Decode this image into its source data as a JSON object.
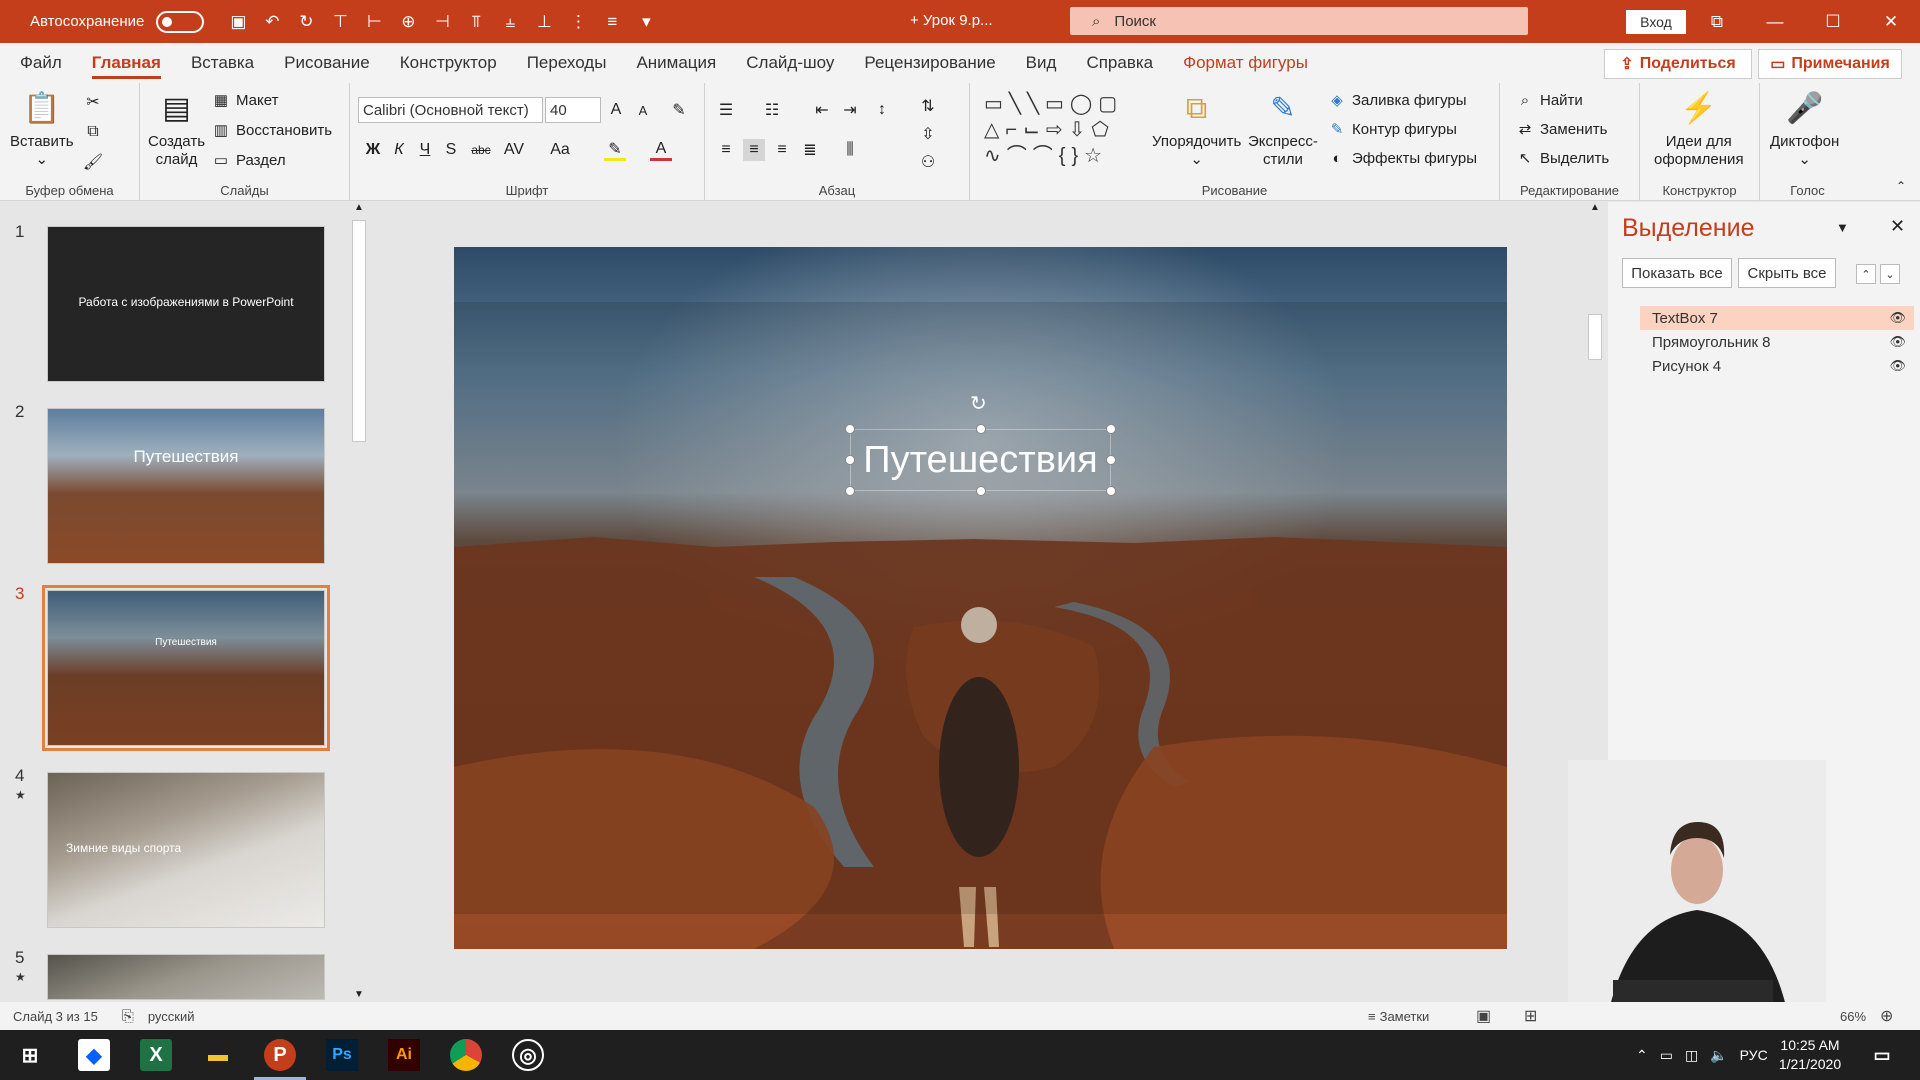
{
  "titlebar": {
    "autosave_label": "Автосохранение",
    "doc_title": "+ Урок 9.р...",
    "search_placeholder": "Поиск",
    "signin": "Вход"
  },
  "tabs": [
    "Файл",
    "Главная",
    "Вставка",
    "Рисование",
    "Конструктор",
    "Переходы",
    "Анимация",
    "Слайд-шоу",
    "Рецензирование",
    "Вид",
    "Справка"
  ],
  "context_tab": "Формат фигуры",
  "share": "Поделиться",
  "comments": "Примечания",
  "ribbon": {
    "clipboard": {
      "paste": "Вставить",
      "label": "Буфер обмена"
    },
    "slides": {
      "new_slide_1": "Создать",
      "new_slide_2": "слайд",
      "layout": "Макет",
      "reset": "Восстановить",
      "section": "Раздел",
      "label": "Слайды"
    },
    "font": {
      "name": "Calibri (Основной текст)",
      "size": "40",
      "bold": "Ж",
      "italic": "К",
      "underline": "Ч",
      "shadow": "S",
      "strike": "abc",
      "spacing": "AV",
      "case": "Aa",
      "label": "Шрифт"
    },
    "paragraph": {
      "label": "Абзац"
    },
    "drawing": {
      "arrange": "Упорядочить",
      "quick_styles_1": "Экспресс-",
      "quick_styles_2": "стили",
      "fill": "Заливка фигуры",
      "outline": "Контур фигуры",
      "effects": "Эффекты фигуры",
      "label": "Рисование"
    },
    "editing": {
      "find": "Найти",
      "replace": "Заменить",
      "select": "Выделить",
      "label": "Редактирование"
    },
    "designer": {
      "ideas_1": "Идеи для",
      "ideas_2": "оформления",
      "label": "Конструктор"
    },
    "voice": {
      "dictate": "Диктофон",
      "label": "Голос"
    }
  },
  "thumbnails": [
    {
      "num": "1",
      "title": "Работа с изображениями в PowerPoint"
    },
    {
      "num": "2",
      "title": "Путешествия"
    },
    {
      "num": "3",
      "title": "Путешествия"
    },
    {
      "num": "4",
      "star": "★",
      "title": "Зимние виды спорта"
    },
    {
      "num": "5",
      "star": "★"
    }
  ],
  "slide": {
    "title": "Путешествия"
  },
  "selection_pane": {
    "title": "Выделение",
    "show_all": "Показать все",
    "hide_all": "Скрыть все",
    "items": [
      "TextBox 7",
      "Прямоугольник 8",
      "Рисунок 4"
    ]
  },
  "status": {
    "slide_info": "Слайд 3 из 15",
    "language": "русский",
    "notes": "Заметки",
    "zoom": "66%"
  },
  "taskbar": {
    "lang": "РУС",
    "time": "10:25 AM",
    "date": "1/21/2020"
  },
  "colors": {
    "accent": "#c43e1c",
    "selected_item": "#fbd3c0",
    "thumb_selected": "#e4803f"
  }
}
